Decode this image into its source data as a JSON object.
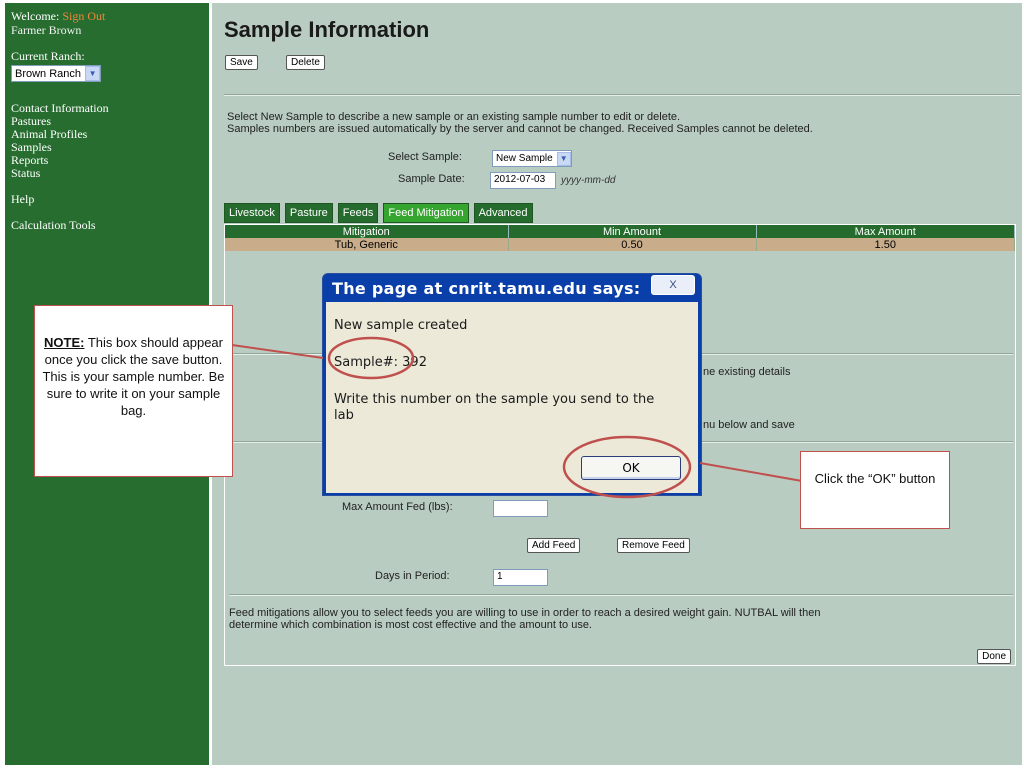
{
  "sidebar": {
    "welcome": "Welcome:",
    "signout": "Sign Out",
    "user": "Farmer Brown",
    "ranch_label": "Current Ranch:",
    "ranch_value": "Brown Ranch",
    "nav": [
      "Contact Information",
      "Pastures",
      "Animal Profiles",
      "Samples",
      "Reports",
      "Status"
    ],
    "help": "Help",
    "calc_tools": "Calculation Tools"
  },
  "main": {
    "title": "Sample Information",
    "save_label": "Save",
    "delete_label": "Delete",
    "intro_line1": "Select New Sample to describe a new sample or an existing sample number to edit or delete.",
    "intro_line2": "Samples numbers are issued automatically by the server and cannot be changed. Received Samples cannot be deleted.",
    "select_sample_label": "Select Sample:",
    "select_sample_value": "New Sample",
    "sample_date_label": "Sample Date:",
    "sample_date_value": "2012-07-03",
    "sample_date_hint": "yyyy-mm-dd"
  },
  "tabs": [
    {
      "label": "Livestock",
      "active": false
    },
    {
      "label": "Pasture",
      "active": false
    },
    {
      "label": "Feeds",
      "active": false
    },
    {
      "label": "Feed Mitigation",
      "active": true
    },
    {
      "label": "Advanced",
      "active": false
    }
  ],
  "mitigation_table": {
    "headers": [
      "Mitigation",
      "Min Amount",
      "Max Amount"
    ],
    "rows": [
      [
        "Tub, Generic",
        "0.50",
        "1.50"
      ]
    ]
  },
  "panel": {
    "partial1": "ne existing details",
    "partial2": "nu below and save",
    "max_amount_label": "Max Amount Fed (lbs):",
    "max_amount_value": "",
    "add_feed_label": "Add Feed",
    "remove_feed_label": "Remove Feed",
    "days_label": "Days in Period:",
    "days_value": "1",
    "footer_line1": "Feed mitigations allow you to select feeds you are willing to use in order to reach a desired weight gain. NUTBAL will then",
    "footer_line2": "determine which combination is most cost effective and the amount to use.",
    "done_label": "Done"
  },
  "dialog": {
    "title": "The page at cnrit.tamu.edu says:",
    "close_label": "X",
    "line1": "New sample created",
    "line2": "Sample#: 392",
    "line3a": "Write this number on the sample you send to the",
    "line3b": "lab",
    "ok_label": "OK"
  },
  "callouts": {
    "note_label": "NOTE:",
    "note_text": "This box should appear once you click the save button.  This is your sample number.  Be sure to write it on your sample bag.",
    "ok_text": "Click the “OK” button"
  },
  "colors": {
    "sidebar_bg": "#276d2f",
    "main_bg": "#b9ccc1",
    "tab_active": "#36a52f",
    "callout_red": "#c0504d"
  }
}
